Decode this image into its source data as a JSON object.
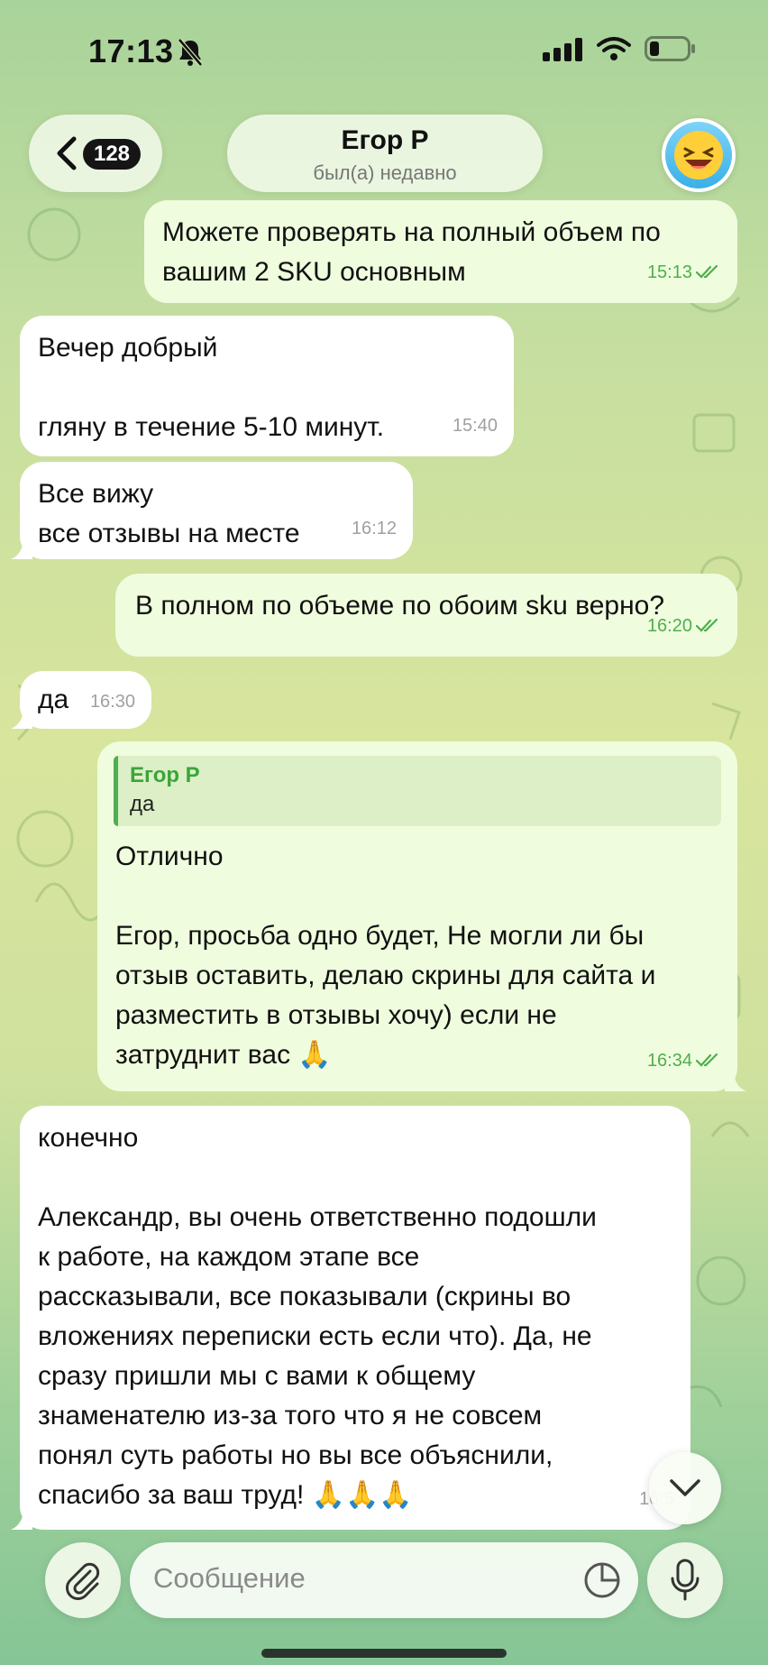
{
  "status_bar": {
    "time": "17:13"
  },
  "header": {
    "unread_count": "128",
    "contact_name": "Егор Р",
    "contact_status": "был(а) недавно"
  },
  "messages": [
    {
      "direction": "out",
      "text": "Можете проверять на полный объем по\nвашим 2 SKU основным",
      "time": "15:13"
    },
    {
      "direction": "in",
      "text": "Вечер добрый\n\nгляну в течение 5-10 минут.",
      "time": "15:40"
    },
    {
      "direction": "in",
      "text": "Все вижу\nвсе отзывы на месте",
      "time": "16:12"
    },
    {
      "direction": "out",
      "text": "В полном по объеме по обоим sku верно?",
      "time": "16:20"
    },
    {
      "direction": "in",
      "text": "да",
      "time": "16:30"
    },
    {
      "direction": "out",
      "reply_to": {
        "name": "Егор Р",
        "text": "да"
      },
      "text": "Отлично\n\nЕгор, просьба одно будет, Не могли ли бы\nотзыв оставить, делаю скрины для сайта и\nразместить в отзывы хочу) если не\nзатруднит вас 🙏",
      "time": "16:34"
    },
    {
      "direction": "in",
      "text": "конечно\n\nАлександр, вы очень ответственно подошли\nк работе, на каждом этапе все\nрассказывали, все показывали (скрины во\nвложениях переписки есть если что). Да, не\nсразу пришли мы с вами к общему\nзнаменателю из-за того что я не совсем\nпонял суть работы но вы все объяснили,\nспасибо за ваш труд! 🙏🙏🙏",
      "time": "16:5"
    }
  ],
  "composer": {
    "placeholder": "Сообщение"
  },
  "colors": {
    "outgoing_bubble": "#effdde",
    "incoming_bubble": "#ffffff",
    "accent_green": "#4fae4e"
  }
}
